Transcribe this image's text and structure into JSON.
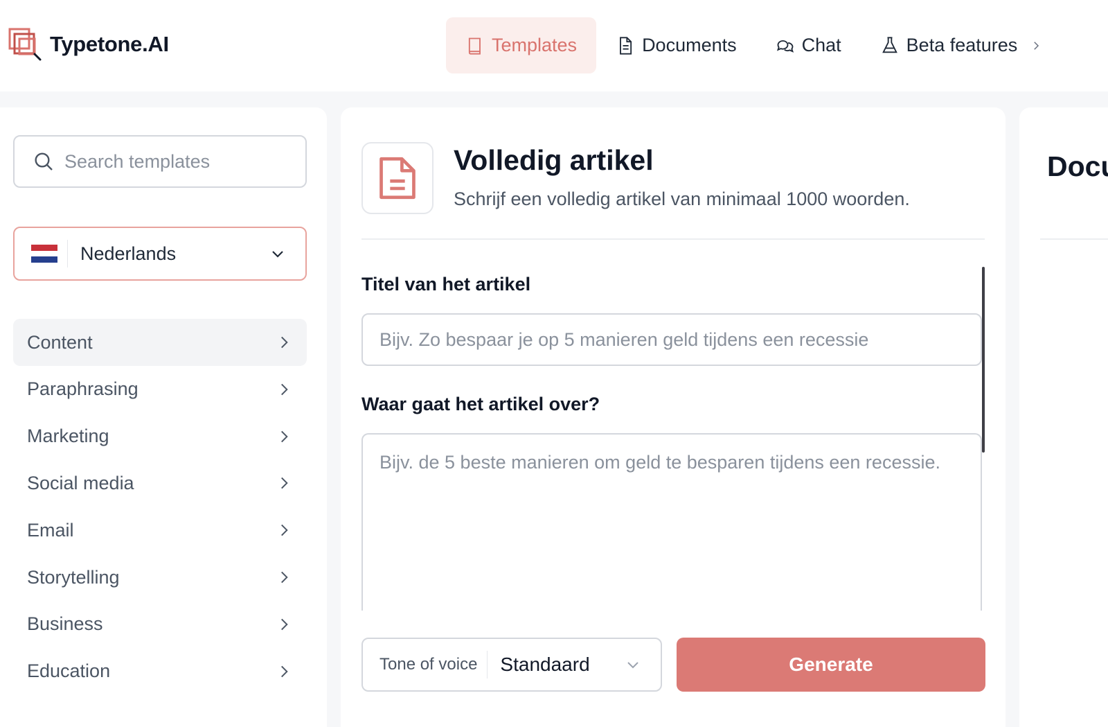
{
  "app": {
    "name": "Typetone.AI"
  },
  "nav": [
    {
      "label": "Templates",
      "icon": "book-icon",
      "active": true
    },
    {
      "label": "Documents",
      "icon": "document-icon",
      "active": false
    },
    {
      "label": "Chat",
      "icon": "chat-bubbles-icon",
      "active": false
    },
    {
      "label": "Beta features",
      "icon": "flask-icon",
      "active": false
    }
  ],
  "sidebar": {
    "search_placeholder": "Search templates",
    "language": "Nederlands",
    "categories": [
      {
        "label": "Content",
        "active": true
      },
      {
        "label": "Paraphrasing"
      },
      {
        "label": "Marketing"
      },
      {
        "label": "Social media"
      },
      {
        "label": "Email"
      },
      {
        "label": "Storytelling"
      },
      {
        "label": "Business"
      },
      {
        "label": "Education"
      }
    ]
  },
  "template": {
    "title": "Volledig artikel",
    "description": "Schrijf een volledig artikel van minimaal 1000 woorden.",
    "fields": [
      {
        "label": "Titel van het artikel",
        "placeholder": "Bijv. Zo bespaar je op 5 manieren geld tijdens een recessie",
        "value": ""
      },
      {
        "label": "Waar gaat het artikel over?",
        "placeholder": "Bijv. de 5 beste manieren om geld te besparen tijdens een recessie.",
        "value": ""
      }
    ],
    "tone_label": "Tone of voice",
    "tone_value": "Standaard",
    "generate_label": "Generate"
  },
  "right_panel": {
    "title": "Docu"
  },
  "colors": {
    "accent": "#db7a75",
    "accent_bg": "#fbeeec",
    "flag_red": "#c8313a",
    "flag_white": "#ffffff",
    "flag_blue": "#253f8e"
  }
}
